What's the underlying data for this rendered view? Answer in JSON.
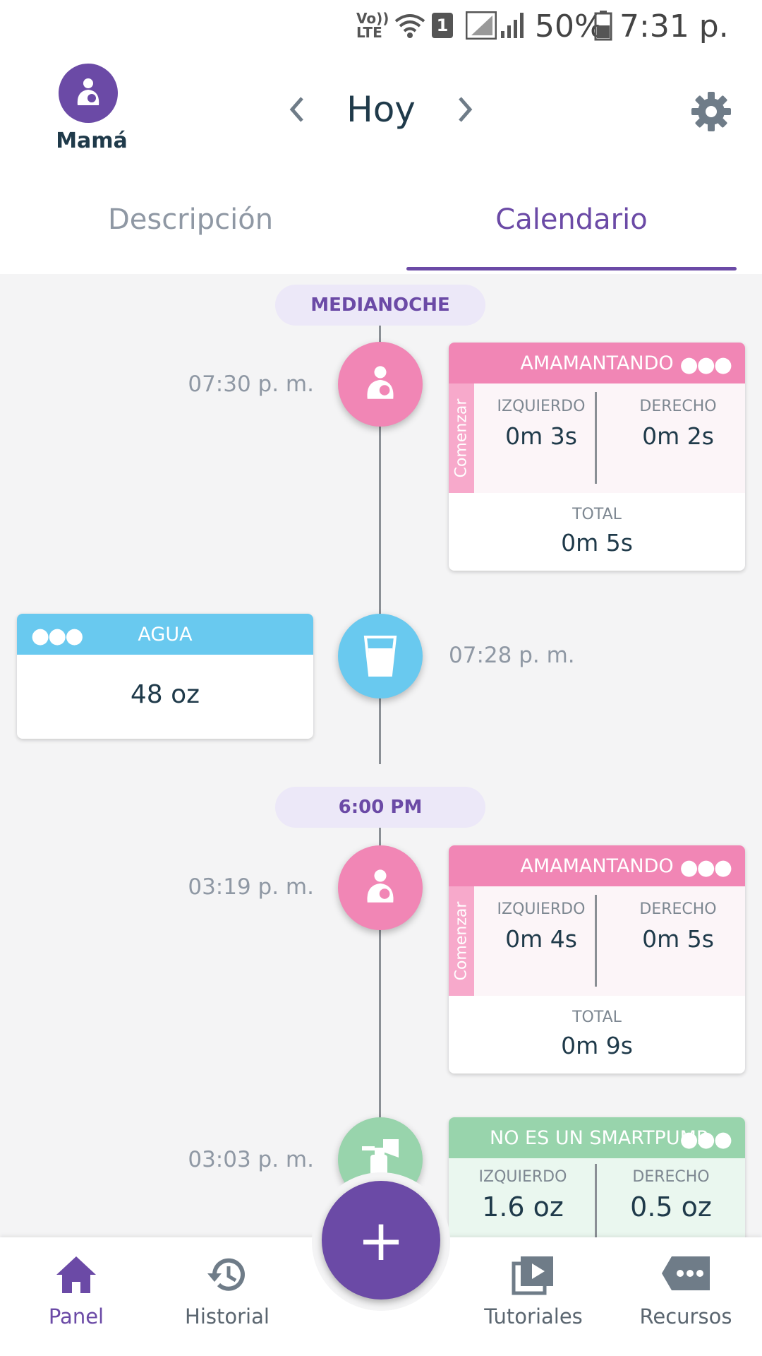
{
  "status_bar": {
    "network": "Vo)) LTE",
    "sim": "1",
    "battery": "50%",
    "time": "7:31 p. m."
  },
  "header": {
    "profile_name": "Mamá",
    "date_title": "Hoy",
    "tabs": [
      {
        "label": "Descripción",
        "active": false
      },
      {
        "label": "Calendario",
        "active": true
      }
    ]
  },
  "timeline": {
    "sections": [
      {
        "label": "MEDIANOCHE",
        "entries": [
          {
            "time": "07:30 p. m.",
            "type": "AMAMANTANDO",
            "side_label": "Comenzar",
            "left_label": "IZQUIERDO",
            "left_value": "0m 3s",
            "right_label": "DERECHO",
            "right_value": "0m 2s",
            "total_label": "TOTAL",
            "total_value": "0m 5s"
          },
          {
            "time": "07:28 p. m.",
            "type": "AGUA",
            "value": "48 oz"
          }
        ]
      },
      {
        "label": "6:00 PM",
        "entries": [
          {
            "time": "03:19 p. m.",
            "type": "AMAMANTANDO",
            "side_label": "Comenzar",
            "left_label": "IZQUIERDO",
            "left_value": "0m 4s",
            "right_label": "DERECHO",
            "right_value": "0m 5s",
            "total_label": "TOTAL",
            "total_value": "0m 9s"
          },
          {
            "time": "03:03 p. m.",
            "type": "NO ES UN SMARTPUMP",
            "left_label": "IZQUIERDO",
            "left_value": "1.6 oz",
            "right_label": "DERECHO",
            "right_value": "0.5 oz"
          }
        ]
      }
    ]
  },
  "fab_label": "+",
  "bottom_nav": [
    {
      "label": "Panel",
      "icon": "home-icon",
      "active": true
    },
    {
      "label": "Historial",
      "icon": "history-icon",
      "active": false
    },
    {
      "label": "Tutoriales",
      "icon": "video-icon",
      "active": false
    },
    {
      "label": "Recursos",
      "icon": "chat-icon",
      "active": false
    }
  ],
  "colors": {
    "brand": "#6b4aa6",
    "nursing": "#f186b5",
    "water": "#69c9ef",
    "pump": "#98d4ac"
  }
}
